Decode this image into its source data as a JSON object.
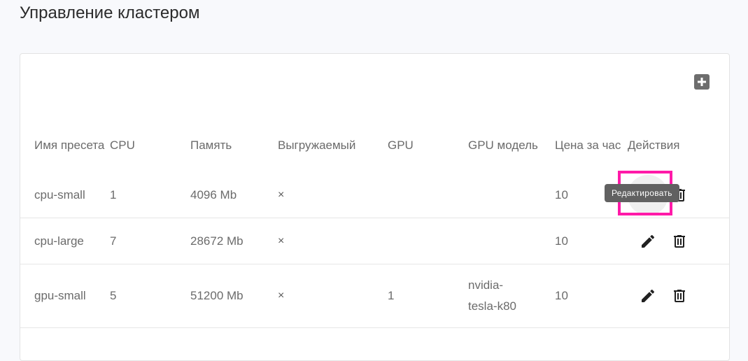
{
  "page": {
    "title": "Управление кластером"
  },
  "toolbar": {
    "add_icon": "plus-box-icon"
  },
  "table": {
    "headers": [
      "Имя пресета",
      "CPU",
      "Память",
      "Выгружаемый",
      "GPU",
      "GPU модель",
      "Цена за час",
      "Действия"
    ],
    "rows": [
      {
        "name": "cpu-small",
        "cpu": "1",
        "memory": "4096 Mb",
        "preemptible": "×",
        "gpu": "",
        "gpu_model": "",
        "price": "10"
      },
      {
        "name": "cpu-large",
        "cpu": "7",
        "memory": "28672 Mb",
        "preemptible": "×",
        "gpu": "",
        "gpu_model": "",
        "price": "10"
      },
      {
        "name": "gpu-small",
        "cpu": "5",
        "memory": "51200 Mb",
        "preemptible": "×",
        "gpu": "1",
        "gpu_model": "nvidia-tesla-k80",
        "price": "10"
      }
    ]
  },
  "tooltip": {
    "text": "Редактировать"
  },
  "colors": {
    "highlight": "#ff1aa8",
    "tooltip_bg": "#616161",
    "icon": "#212121"
  },
  "icons": {
    "edit": "pencil-icon",
    "delete": "trash-icon"
  }
}
